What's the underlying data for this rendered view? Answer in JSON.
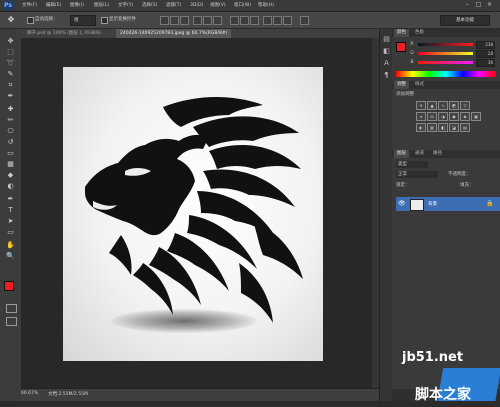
{
  "app": {
    "logo": "Ps"
  },
  "menus": [
    "文件(F)",
    "编辑(E)",
    "图像(I)",
    "图层(L)",
    "文字(Y)",
    "选择(S)",
    "滤镜(T)",
    "3D(D)",
    "视图(V)",
    "窗口(W)",
    "帮助(H)"
  ],
  "window_controls": {
    "minimize": "–",
    "maximize": "□",
    "close": "×"
  },
  "options_bar": {
    "auto_select_label": "自动选择：",
    "auto_select_value": "组",
    "show_transform_label": "显示变换控件",
    "workspace": "基本功能"
  },
  "document_tabs": [
    {
      "label": "狮子.psd @ 100% (图层 1, RGB/8)",
      "active": false
    },
    {
      "label": "240426-140925209783.jpeg @ 66.7%(RGB/8#)",
      "active": true
    }
  ],
  "status": {
    "zoom": "66.67%",
    "doc_info": "文档:2.55M/2.55M"
  },
  "color_panel": {
    "tabs": [
      "颜色",
      "色板"
    ],
    "channels": [
      {
        "name": "R",
        "value": "238"
      },
      {
        "name": "G",
        "value": "28"
      },
      {
        "name": "B",
        "value": "36"
      }
    ],
    "foreground": "#ee1c24",
    "background": "#ffffff"
  },
  "adjustments_panel": {
    "tabs": [
      "调整",
      "样式"
    ],
    "title": "添加调整"
  },
  "layers_panel": {
    "tabs": [
      "图层",
      "通道",
      "路径"
    ],
    "kind_filter": "类型",
    "blend_mode": "正常",
    "opacity_label": "不透明度：",
    "lock_label": "锁定：",
    "fill_label": "填充：",
    "layer_name": "背景"
  },
  "watermark": {
    "site": "jb51.net",
    "brand": "脚本之家"
  },
  "icons": {
    "move": "✥",
    "marquee": "⬚",
    "lasso": "➰",
    "quick_select": "✎",
    "crop": "⌗",
    "eyedropper": "✒",
    "heal": "✚",
    "brush": "✏",
    "stamp": "⎔",
    "history_brush": "↺",
    "eraser": "▭",
    "gradient": "▦",
    "blur": "◆",
    "dodge": "◐",
    "pen": "✒",
    "type": "T",
    "path_select": "➤",
    "shape": "▭",
    "hand": "✋",
    "zoom": "🔍"
  }
}
